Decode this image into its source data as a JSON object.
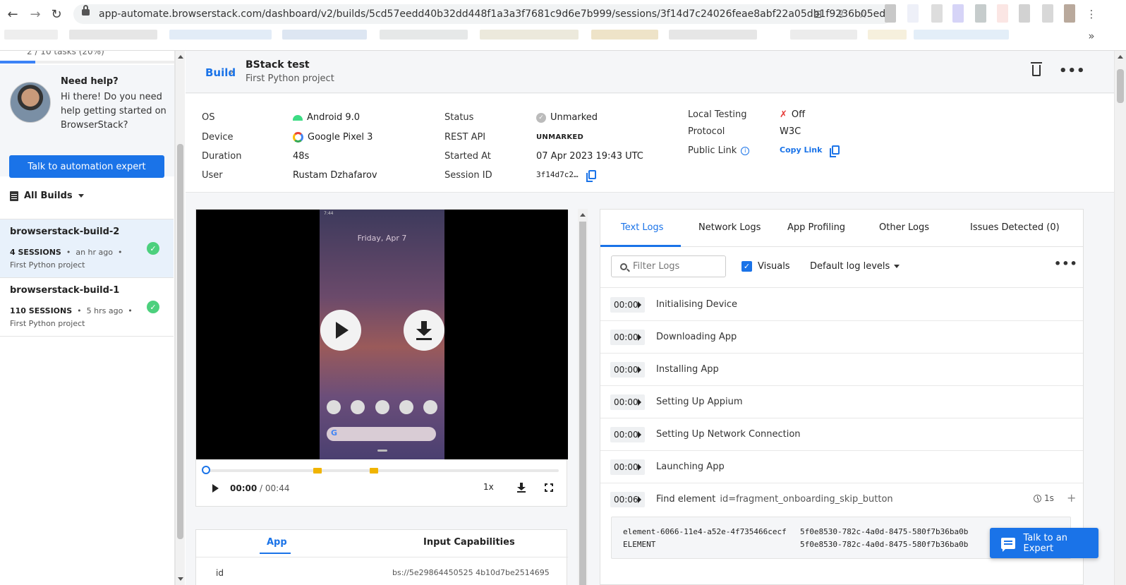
{
  "browser": {
    "url": "app-automate.browserstack.com/dashboard/v2/builds/5cd57eedd40b32dd448f1a3a3f7681c9d6e7b999/sessions/3f14d7c24026feae8abf22a05db1f9236b05edee7",
    "back_icon": "arrow-left-icon",
    "forward_icon": "arrow-right-icon",
    "reload_icon": "reload-icon",
    "overflow_label": "»"
  },
  "sidebar": {
    "progress_text": "2 / 10 tasks (20%)",
    "progress_fraction": 0.2,
    "help_title": "Need help?",
    "help_body": "Hi there! Do you need help getting started on BrowserStack?",
    "talk_button": "Talk to automation expert",
    "all_builds_label": "All Builds",
    "builds": [
      {
        "name": "browserstack-build-2",
        "sessions": "4 SESSIONS",
        "age": "an hr ago",
        "project": "First Python project",
        "status": "passed"
      },
      {
        "name": "browserstack-build-1",
        "sessions": "110 SESSIONS",
        "age": "5 hrs ago",
        "project": "First Python project",
        "status": "passed"
      }
    ]
  },
  "header": {
    "crumb": "Build",
    "title": "BStack test",
    "subtitle": "First Python project"
  },
  "info": {
    "os_label": "OS",
    "os_value": "Android 9.0",
    "device_label": "Device",
    "device_value": "Google Pixel 3",
    "duration_label": "Duration",
    "duration_value": "48s",
    "user_label": "User",
    "user_value": "Rustam Dzhafarov",
    "status_label": "Status",
    "status_value": "Unmarked",
    "rest_label": "REST API",
    "rest_value": "UNMARKED",
    "started_label": "Started At",
    "started_value": "07 Apr 2023 19:43 UTC",
    "session_label": "Session ID",
    "session_value": "3f14d7c2…",
    "local_label": "Local Testing",
    "local_value": "Off",
    "protocol_label": "Protocol",
    "protocol_value": "W3C",
    "public_label": "Public Link",
    "public_value": "Copy Link"
  },
  "video": {
    "phone_date": "Friday, Apr 7",
    "phone_status": "7:44",
    "current_time": "00:00",
    "total_time": "/ 00:44",
    "speed": "1x"
  },
  "caps": {
    "tabs": [
      "App",
      "Input Capabilities"
    ],
    "first_key": "id",
    "first_value": "bs://5e29864450525 4b10d7be2514695"
  },
  "logs": {
    "tabs": [
      "Text Logs",
      "Network Logs",
      "App Profiling",
      "Other Logs",
      "Issues Detected (0)"
    ],
    "filter_placeholder": "Filter Logs",
    "visuals_label": "Visuals",
    "log_levels_label": "Default log levels",
    "rows": [
      {
        "time": "00:00",
        "text": "Initialising Device"
      },
      {
        "time": "00:00",
        "text": "Downloading App"
      },
      {
        "time": "00:00",
        "text": "Installing App"
      },
      {
        "time": "00:00",
        "text": "Setting Up Appium"
      },
      {
        "time": "00:00",
        "text": "Setting Up Network Connection"
      },
      {
        "time": "00:00",
        "text": "Launching App"
      },
      {
        "time": "00:06",
        "text": "Find element",
        "arg": "id=fragment_onboarding_skip_button",
        "duration": "1s"
      }
    ],
    "code": [
      {
        "key": "element-6066-11e4-a52e-4f735466cecf",
        "value": "5f0e8530-782c-4a0d-8475-580f7b36ba0b"
      },
      {
        "key": "ELEMENT",
        "value": "5f0e8530-782c-4a0d-8475-580f7b36ba0b"
      }
    ]
  },
  "expert_button": "Talk to an Expert",
  "colors": {
    "accent": "#1a73e8",
    "success": "#4cd07d",
    "marker": "#f0b400"
  }
}
